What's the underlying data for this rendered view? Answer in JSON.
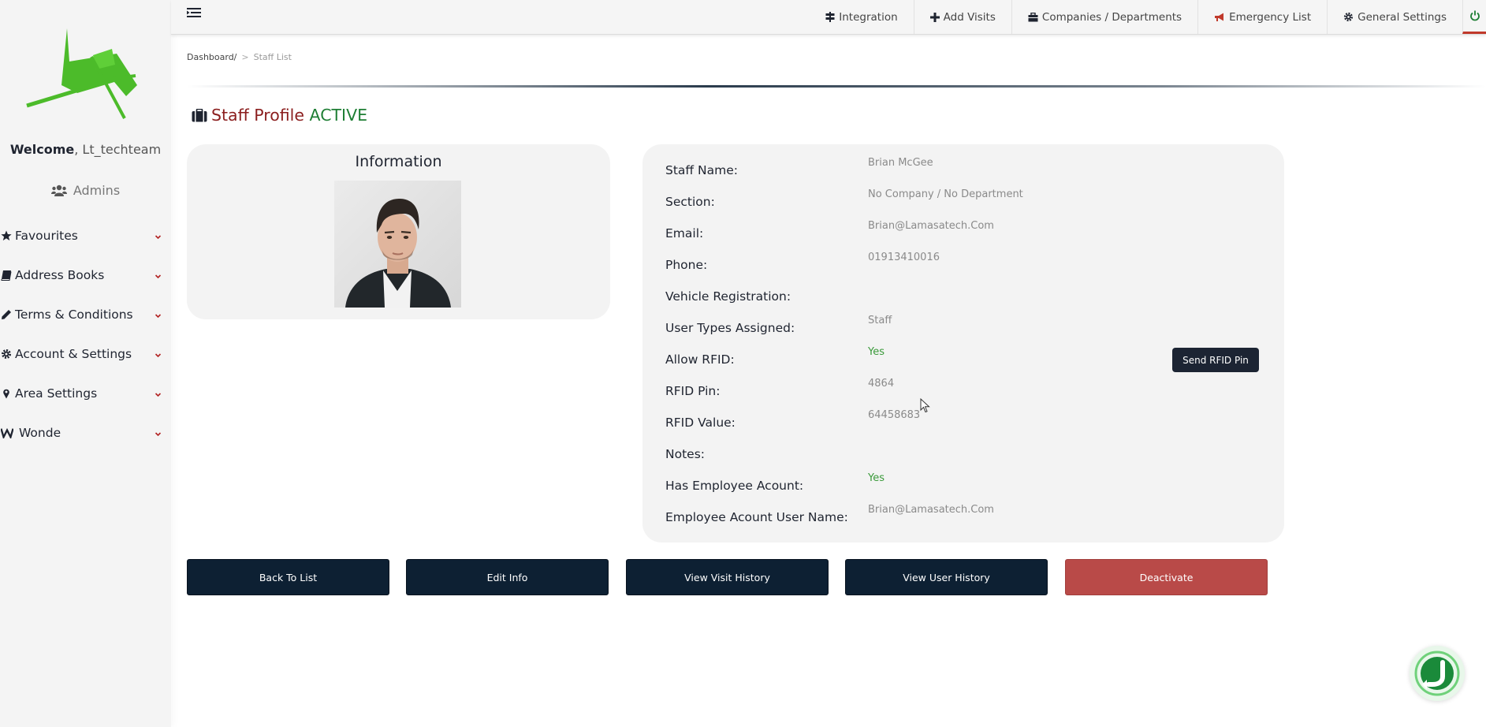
{
  "sidebar": {
    "welcome_label": "Welcome",
    "username": ", Lt_techteam",
    "role": "Admins",
    "items": [
      {
        "label": "Favourites",
        "icon": "star-icon"
      },
      {
        "label": "Address Books",
        "icon": "book-icon"
      },
      {
        "label": "Terms & Conditions",
        "icon": "pencil-icon"
      },
      {
        "label": "Account & Settings",
        "icon": "gear-icon"
      },
      {
        "label": "Area Settings",
        "icon": "map-pin-icon"
      },
      {
        "label": "Wonde",
        "icon": "w-icon"
      }
    ]
  },
  "topnav": {
    "items": [
      {
        "label": "Integration",
        "icon": "signpost-icon"
      },
      {
        "label": "Add Visits",
        "icon": "plus-icon"
      },
      {
        "label": "Companies / Departments",
        "icon": "briefcase-icon"
      },
      {
        "label": "Emergency List",
        "icon": "megaphone-icon"
      },
      {
        "label": "General Settings",
        "icon": "gear-icon"
      }
    ]
  },
  "breadcrumb": {
    "root": "Dashboard/",
    "separator": ">",
    "current": "Staff List"
  },
  "page": {
    "title": "Staff Profile",
    "status": "ACTIVE"
  },
  "info": {
    "title": "Information"
  },
  "details": [
    {
      "label": "Staff Name:",
      "value": "Brian McGee"
    },
    {
      "label": "Section:",
      "value": "No Company / No Department"
    },
    {
      "label": "Email:",
      "value": "Brian@Lamasatech.Com"
    },
    {
      "label": "Phone:",
      "value": "01913410016"
    },
    {
      "label": "Vehicle Registration:",
      "value": ""
    },
    {
      "label": "User Types Assigned:",
      "value": "Staff"
    },
    {
      "label": "Allow RFID:",
      "value": "Yes"
    },
    {
      "label": "RFID Pin:",
      "value": "4864"
    },
    {
      "label": "RFID Value:",
      "value": "64458683"
    },
    {
      "label": "Notes:",
      "value": ""
    },
    {
      "label": "Has Employee Acount:",
      "value": "Yes"
    },
    {
      "label": "Employee Acount User Name:",
      "value": "Brian@Lamasatech.Com"
    }
  ],
  "send_rfid_label": "Send RFID Pin",
  "actions": {
    "back": "Back To List",
    "edit": "Edit Info",
    "visit_history": "View Visit History",
    "user_history": "View User History",
    "deactivate": "Deactivate"
  },
  "colors": {
    "title_red": "#8b1e1e",
    "status_green": "#1e7e34",
    "button_dark": "#0d2033",
    "button_red": "#b94a48",
    "logo_green": "#4cbb2a"
  }
}
